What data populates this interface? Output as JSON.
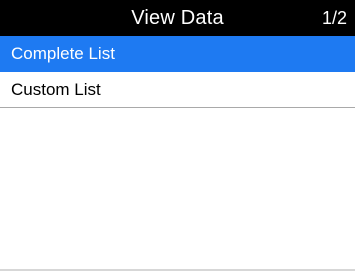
{
  "header": {
    "title": "View Data",
    "page_indicator": "1/2"
  },
  "list": {
    "items": [
      {
        "label": "Complete List",
        "selected": true
      },
      {
        "label": "Custom List",
        "selected": false
      }
    ]
  },
  "colors": {
    "header_bg": "#000000",
    "selected_bg": "#1e7af2",
    "selected_text": "#ffffff",
    "item_text": "#000000",
    "divider": "#a9a9a9"
  }
}
